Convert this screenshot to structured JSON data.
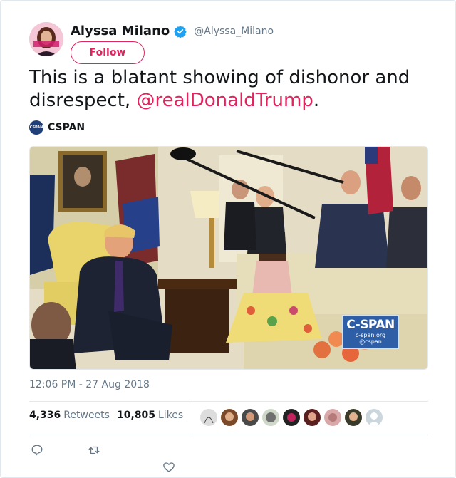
{
  "author": {
    "display_name": "Alyssa Milano",
    "handle": "@Alyssa_Milano",
    "avatar_text": "Unbreakable",
    "verified": true
  },
  "follow_button": {
    "label": "Follow"
  },
  "tweet": {
    "text": "This is a blatant showing of dishonor and disrespect, ",
    "mention": "@realDonaldTrump",
    "suffix": "."
  },
  "media_source": {
    "logo_text": "CSPAN",
    "name": "CSPAN"
  },
  "video_badge": {
    "title": "C-SPAN",
    "site": "c-span.org",
    "handle": "@cspan"
  },
  "timestamp": "12:06 PM - 27 Aug 2018",
  "stats": {
    "retweets_count": "4,336",
    "retweets_label": "Retweets",
    "likes_count": "10,805",
    "likes_label": "Likes"
  },
  "likers": [
    "liker-1",
    "liker-2",
    "liker-3",
    "liker-4",
    "liker-5",
    "liker-6",
    "liker-7",
    "liker-8",
    "liker-9"
  ],
  "actions": [
    "reply-icon",
    "retweet-icon",
    "like-icon"
  ],
  "colors": {
    "accent": "#e0245e",
    "verified": "#1da1f2",
    "muted": "#657786"
  }
}
